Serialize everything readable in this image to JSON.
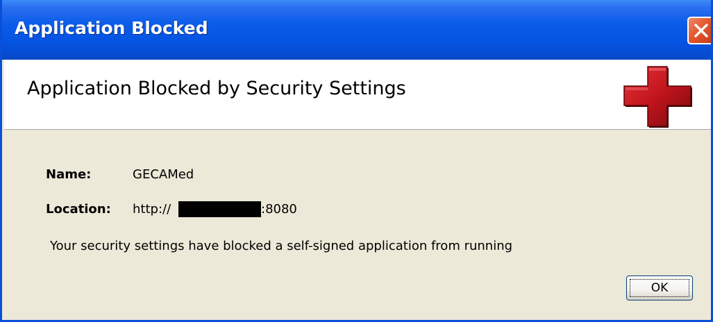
{
  "window": {
    "title": "Application Blocked"
  },
  "header": {
    "title": "Application Blocked by Security Settings",
    "icon": "red-cross-icon",
    "icon_color": "#c0141c"
  },
  "fields": {
    "name_label": "Name:",
    "name_value": "GECAMed",
    "location_label": "Location:",
    "location_prefix": "http://",
    "location_suffix": ":8080"
  },
  "message": "Your security settings have blocked a self-signed application from running",
  "buttons": {
    "ok_label": "OK"
  },
  "colors": {
    "titlebar": "#0553e2",
    "dialog_bg": "#ece9d8",
    "close_button": "#e2582e"
  }
}
